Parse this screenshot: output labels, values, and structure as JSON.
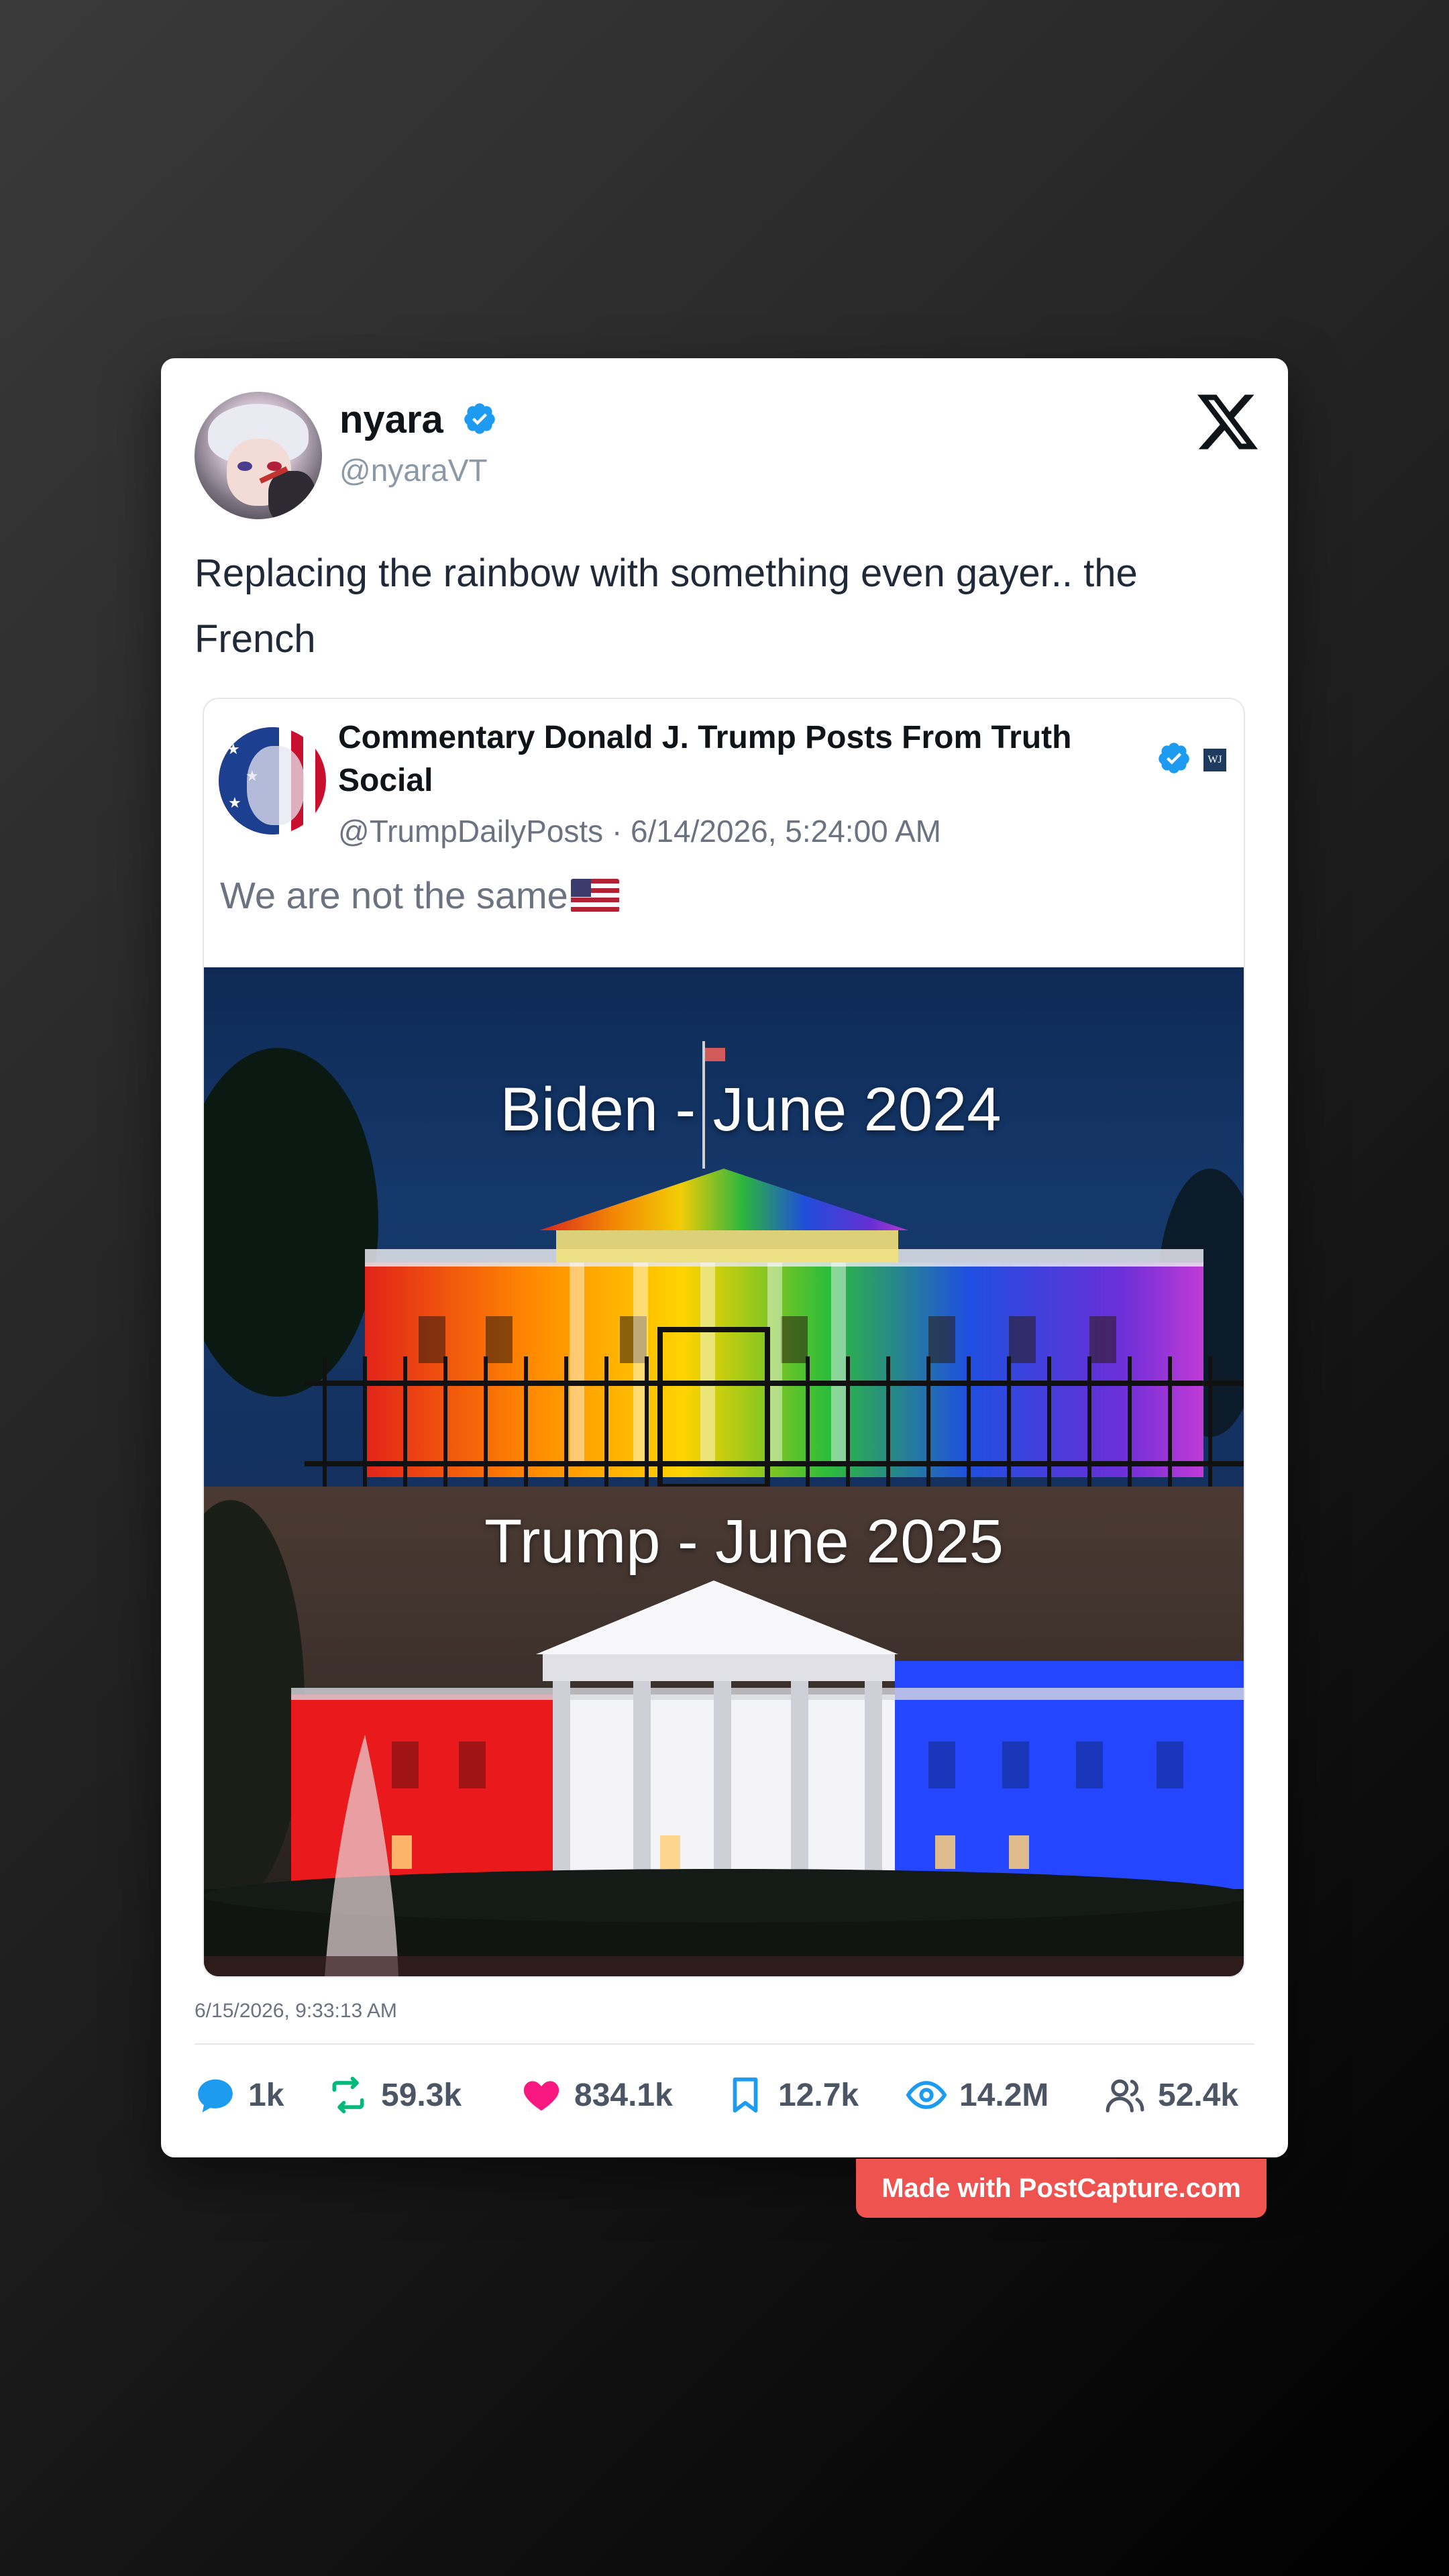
{
  "tweet": {
    "author_name": "nyara",
    "author_handle": "@nyaraVT",
    "text": "Replacing the rainbow with something even gayer.. the French",
    "timestamp": "6/15/2026, 9:33:13 AM",
    "logo_icon": "x-logo-icon",
    "verified_color": "#1d9bf0"
  },
  "quote": {
    "author_name": "Commentary Donald J. Trump Posts From Truth Social",
    "author_meta": "@TrumpDailyPosts · 6/14/2026, 5:24:00 AM",
    "badge": "WJ",
    "text": "We are not the same",
    "image_top_caption": "Biden - June 2024",
    "image_bottom_caption": "Trump - June 2025"
  },
  "stats": {
    "replies": "1k",
    "retweets": "59.3k",
    "likes": "834.1k",
    "bookmarks": "12.7k",
    "views": "14.2M",
    "followers": "52.4k"
  },
  "colors": {
    "reply": "#1d9bf0",
    "retweet": "#00ba7c",
    "like": "#f91880",
    "bookmark": "#1d9bf0",
    "views": "#1d9bf0",
    "followers": "#4b5563",
    "watermark": "#ef5350"
  },
  "watermark": "Made with PostCapture.com"
}
